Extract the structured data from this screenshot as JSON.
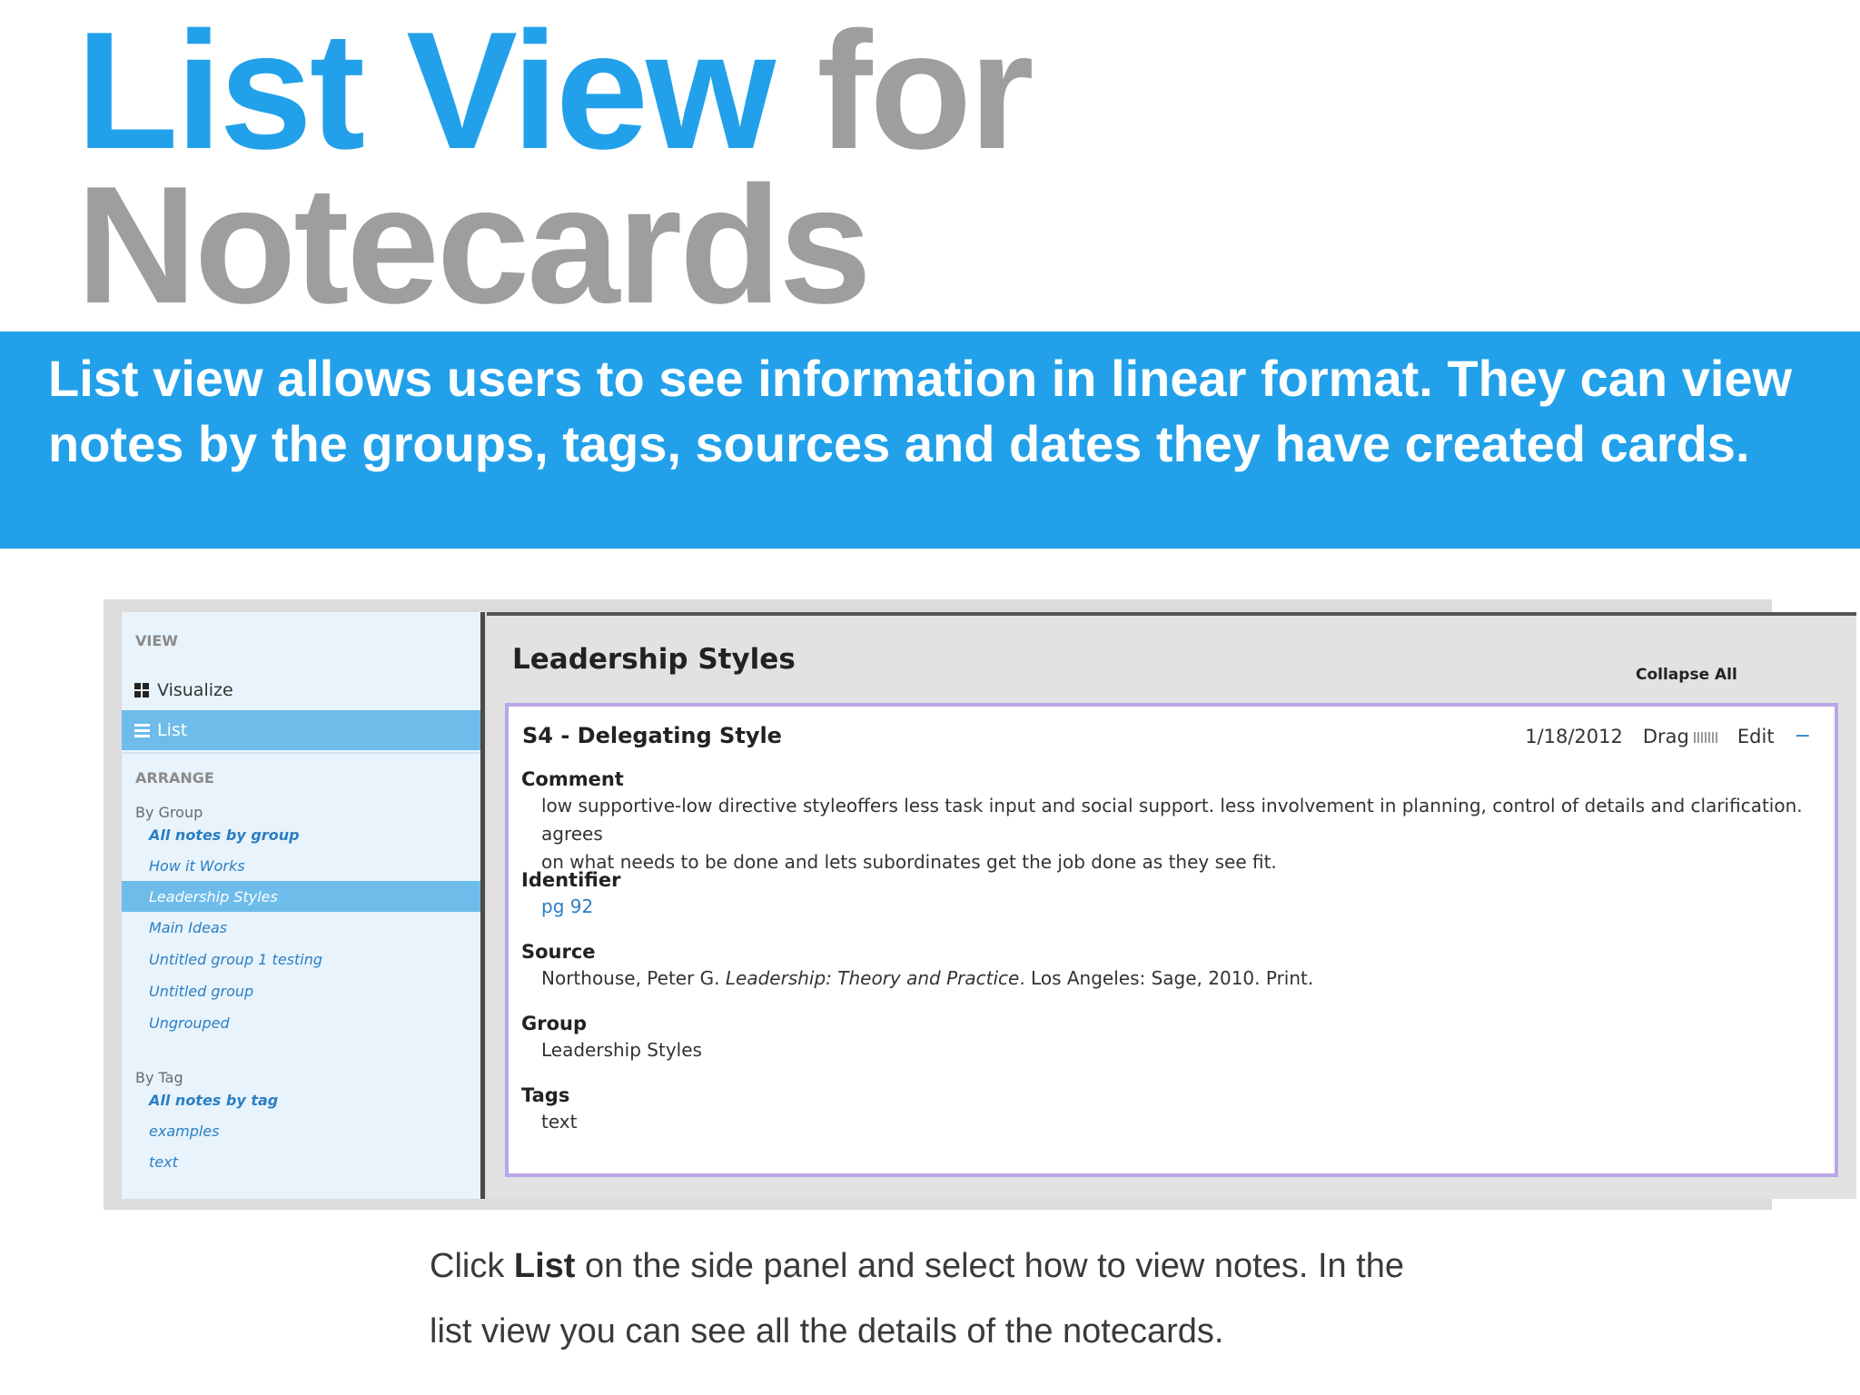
{
  "title": {
    "line1_blue": "List View",
    "line1_gray": "for",
    "line2_gray": "Notecards"
  },
  "banner": {
    "text": "List view allows users to see information in linear format. They can view notes by the groups, tags, sources and dates they have created cards."
  },
  "colors": {
    "accent_blue": "#22a1ea",
    "title_gray": "#9e9e9e",
    "sidebar_active": "#6ebcea",
    "card_border": "#b8a6e6",
    "link_blue": "#2b7fc4"
  },
  "sidebar": {
    "view_heading": "VIEW",
    "visualize": {
      "label": "Visualize",
      "icon": "grid-icon"
    },
    "list": {
      "label": "List",
      "icon": "list-icon"
    },
    "arrange_heading": "ARRANGE",
    "by_group_heading": "By Group",
    "groups": [
      "All notes by group",
      "How it Works",
      "Leadership Styles",
      "Main Ideas",
      "Untitled group 1 testing",
      "Untitled group",
      "Ungrouped"
    ],
    "by_tag_heading": "By Tag",
    "tags": [
      "All notes by tag",
      "examples",
      "text"
    ]
  },
  "main": {
    "group_title": "Leadership Styles",
    "collapse_all": "Collapse All",
    "card": {
      "title": "S4 - Delegating Style",
      "date": "1/18/2012",
      "drag": "Drag",
      "edit": "Edit",
      "collapse_symbol": "−",
      "comment_label": "Comment",
      "comment_line1": "low supportive-low directive styleoffers less task input and social support. less involvement in planning, control of details and clarification. agrees",
      "comment_line2": "on what needs to be done and lets subordinates get the job done as they see fit.",
      "identifier_label": "Identifier",
      "identifier": "pg 92",
      "source_label": "Source",
      "source_prefix": "Northouse, Peter G. ",
      "source_title": "Leadership: Theory and Practice",
      "source_suffix": ". Los Angeles: Sage, 2010. Print.",
      "group_label": "Group",
      "group": "Leadership Styles",
      "tags_label": "Tags",
      "tags": "text"
    }
  },
  "caption": {
    "prefix": "Click ",
    "bold": "List",
    "line1_rest": " on the side panel and select how to view notes. In the",
    "line2": "list view you can see all the details of the notecards."
  }
}
